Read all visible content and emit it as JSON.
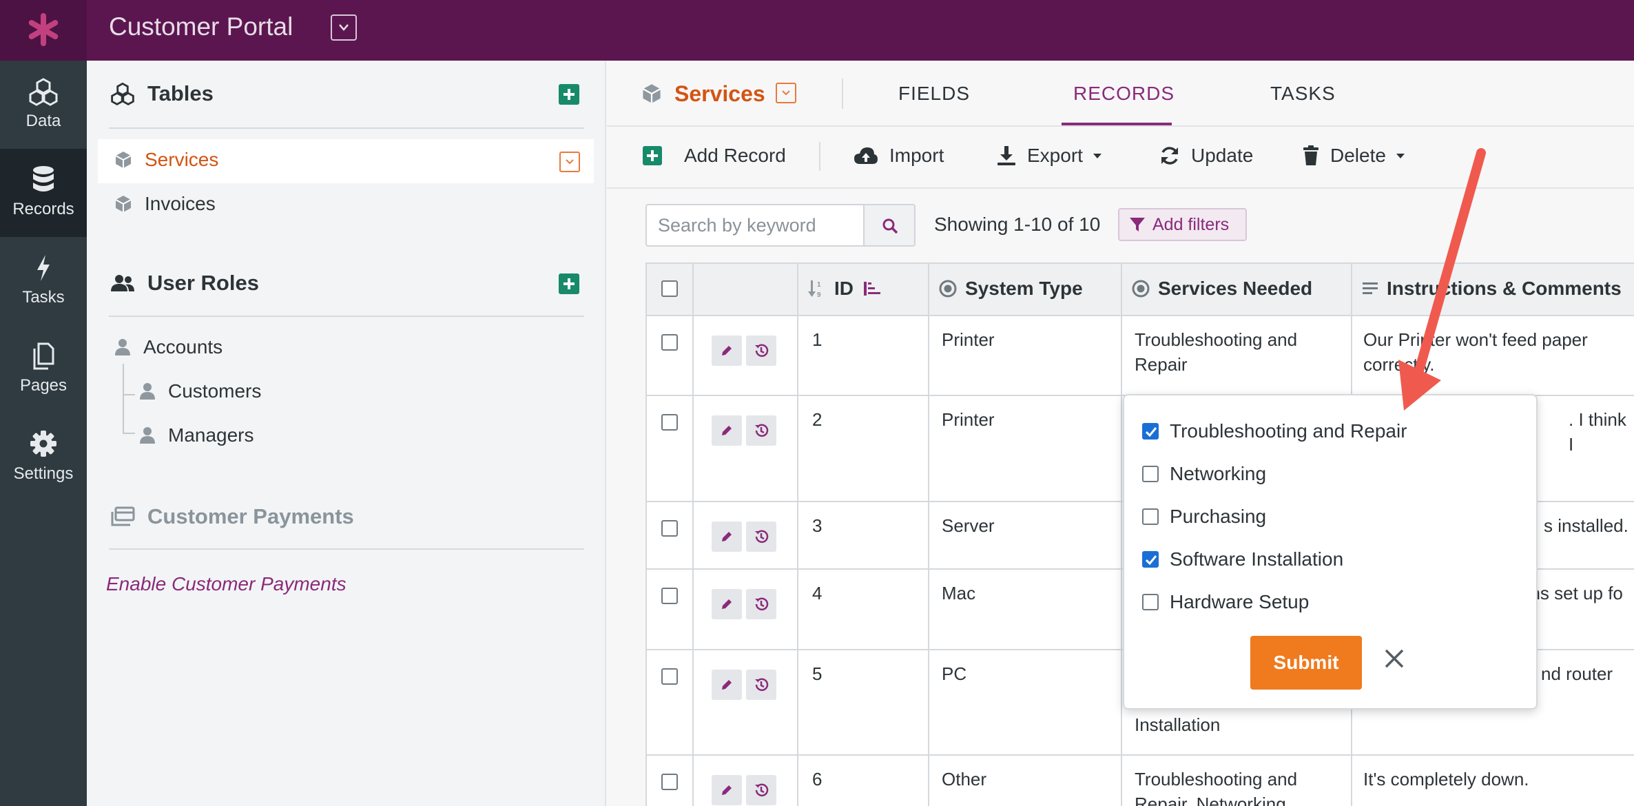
{
  "app": {
    "title": "Customer Portal"
  },
  "leftnav": {
    "items": [
      {
        "label": "Data",
        "icon": "cubes-icon"
      },
      {
        "label": "Records",
        "icon": "database-icon"
      },
      {
        "label": "Tasks",
        "icon": "bolt-icon"
      },
      {
        "label": "Pages",
        "icon": "pages-icon"
      },
      {
        "label": "Settings",
        "icon": "gear-icon"
      }
    ],
    "active": "Records"
  },
  "sidebar": {
    "tables_heading": "Tables",
    "tables": [
      {
        "label": "Services",
        "active": true
      },
      {
        "label": "Invoices",
        "active": false
      }
    ],
    "user_roles_heading": "User Roles",
    "roles": [
      {
        "label": "Accounts"
      },
      {
        "label": "Customers"
      },
      {
        "label": "Managers"
      }
    ],
    "payments_heading": "Customer Payments",
    "enable_payments_link": "Enable Customer Payments"
  },
  "main": {
    "table_name": "Services",
    "tabs": [
      {
        "label": "FIELDS",
        "active": false
      },
      {
        "label": "RECORDS",
        "active": true
      },
      {
        "label": "TASKS",
        "active": false
      }
    ],
    "toolbar": {
      "add_record": "Add Record",
      "import": "Import",
      "export": "Export",
      "update": "Update",
      "delete": "Delete"
    },
    "search": {
      "placeholder": "Search by keyword",
      "value": ""
    },
    "showing": "Showing 1-10 of 10",
    "add_filters": "Add filters"
  },
  "grid": {
    "columns": [
      "ID",
      "System Type",
      "Services Needed",
      "Instructions & Comments"
    ],
    "rows": [
      {
        "id": "1",
        "system_type": "Printer",
        "services": [
          "Troubleshooting and",
          "Repair"
        ],
        "comments": [
          "Our Printer won't feed paper",
          "correctly."
        ]
      },
      {
        "id": "2",
        "system_type": "Printer",
        "services": [],
        "comments": [
          ". I think I"
        ]
      },
      {
        "id": "3",
        "system_type": "Server",
        "services": [],
        "comments": [
          "s installed."
        ]
      },
      {
        "id": "4",
        "system_type": "Mac",
        "services": [],
        "comments": [
          "ons set up fo"
        ]
      },
      {
        "id": "5",
        "system_type": "PC",
        "services": [
          "Installation"
        ],
        "comments": [
          "nd router"
        ]
      },
      {
        "id": "6",
        "system_type": "Other",
        "services": [
          "Troubleshooting and",
          "Repair, Networking"
        ],
        "comments": [
          "It's completely down."
        ]
      }
    ]
  },
  "popup": {
    "options": [
      {
        "label": "Troubleshooting and Repair",
        "checked": true
      },
      {
        "label": "Networking",
        "checked": false
      },
      {
        "label": "Purchasing",
        "checked": false
      },
      {
        "label": "Software Installation",
        "checked": true
      },
      {
        "label": "Hardware Setup",
        "checked": false
      }
    ],
    "submit": "Submit"
  },
  "colors": {
    "topbar": "#5b1650",
    "leftnav": "#2f3a41",
    "accent_purple": "#8a2a7a",
    "accent_orange": "#f07a1e",
    "green_plus": "#178a6a",
    "checkbox_blue": "#1a6fd6",
    "annotation_arrow": "#f05a4e"
  }
}
